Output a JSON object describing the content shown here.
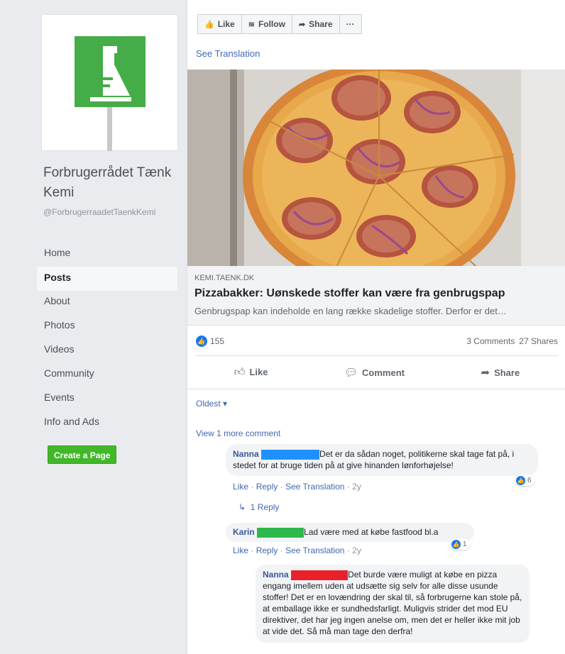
{
  "sidebar": {
    "page_name": "Forbrugerrådet Tænk Kemi",
    "page_handle": "@ForbrugerraadetTaenkKemi",
    "nav": [
      "Home",
      "Posts",
      "About",
      "Photos",
      "Videos",
      "Community",
      "Events",
      "Info and Ads"
    ],
    "active_nav": "Posts",
    "create_page": "Create a Page",
    "logo_color": "#45ad47"
  },
  "action_bar": {
    "like": "Like",
    "follow": "Follow",
    "share": "Share",
    "more": "···"
  },
  "post": {
    "see_translation": "See Translation",
    "image_icon": "pizza-photo",
    "link": {
      "domain": "KEMI.TAENK.DK",
      "title": "Pizzabakker: Uønskede stoffer kan være fra genbrugspap",
      "description": "Genbrugspap kan indeholde en lang række skadelige stoffer. Derfor er det…"
    },
    "reactions": "155",
    "comments_count": "3 Comments",
    "shares_count": "27 Shares",
    "actions": {
      "like": "Like",
      "comment": "Comment",
      "share": "Share"
    },
    "sort": "Oldest ▾",
    "view_more": "View 1 more comment"
  },
  "comments": [
    {
      "name": "Nanna",
      "redact_color": "#1e90ff",
      "text": "Det er da sådan noget, politikerne skal tage fat på, i stedet for at bruge tiden på at give hinanden lønforhøjelse!",
      "like": "Like",
      "reply": "Reply",
      "translation": "See Translation",
      "age": "2y",
      "reaction_count": "6",
      "replies": "1 Reply"
    },
    {
      "name": "Karin",
      "redact_color": "#2db84b",
      "text": "Lad være med at købe fastfood bl.a",
      "like": "Like",
      "reply": "Reply",
      "translation": "See Translation",
      "age": "2y",
      "reaction_count": "1"
    },
    {
      "name": "Nanna",
      "redact_color": "#e8212b",
      "text": "Det burde være muligt at købe en pizza engang imellem uden at udsætte sig selv for alle disse usunde stoffer! Det er en lovændring der skal til, så forbrugerne kan stole på, at emballage ikke er sundhedsfarligt. Muligvis strider det mod EU direktiver, det har jeg ingen anelse om, men det er heller ikke mit job at vide det. Så må man tage den derfra!"
    }
  ]
}
